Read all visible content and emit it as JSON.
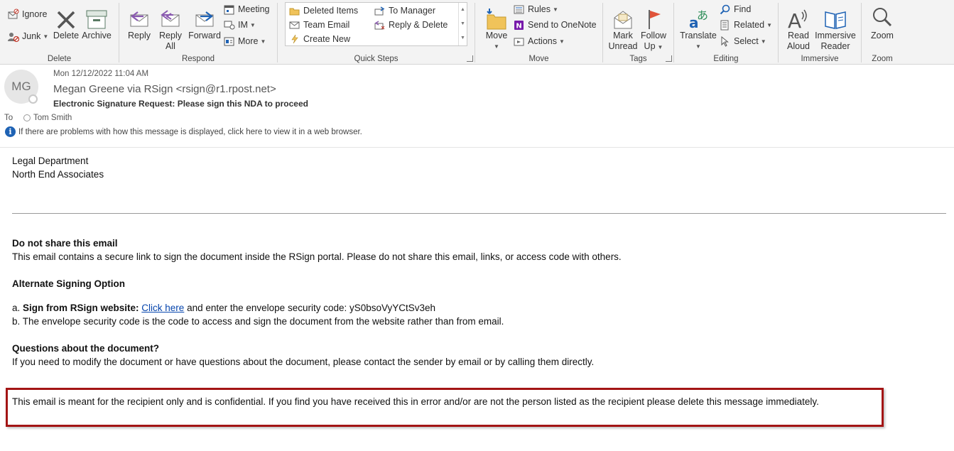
{
  "ribbon": {
    "delete": {
      "label": "Delete",
      "ignore": "Ignore",
      "junk": "Junk",
      "delete_btn": "Delete",
      "archive": "Archive"
    },
    "respond": {
      "label": "Respond",
      "reply": "Reply",
      "reply_all_1": "Reply",
      "reply_all_2": "All",
      "forward": "Forward",
      "meeting": "Meeting",
      "im": "IM",
      "more": "More"
    },
    "quick_steps": {
      "label": "Quick Steps",
      "items": [
        "Deleted Items",
        "To Manager",
        "Team Email",
        "Reply & Delete",
        "Create New"
      ]
    },
    "move": {
      "label": "Move",
      "move_btn": "Move",
      "rules": "Rules",
      "send_onenote": "Send to OneNote",
      "actions": "Actions"
    },
    "tags": {
      "label": "Tags",
      "mark_1": "Mark",
      "mark_2": "Unread",
      "follow_1": "Follow",
      "follow_2": "Up"
    },
    "editing": {
      "label": "Editing",
      "translate": "Translate",
      "find": "Find",
      "related": "Related",
      "select": "Select"
    },
    "immersive": {
      "label": "Immersive",
      "read_1": "Read",
      "read_2": "Aloud",
      "reader_1": "Immersive",
      "reader_2": "Reader"
    },
    "zoom": {
      "label": "Zoom",
      "zoom_btn": "Zoom"
    }
  },
  "header": {
    "avatar_initials": "MG",
    "date": "Mon 12/12/2022 11:04 AM",
    "from": "Megan Greene via RSign <rsign@r1.rpost.net>",
    "subject": "Electronic Signature Request: Please sign this NDA to proceed",
    "to_label": "To",
    "to_name": "Tom Smith",
    "info_message": "If there are problems with how this message is displayed, click here to view it in a web browser."
  },
  "body": {
    "sig_line1": "Legal Department",
    "sig_line2": "North End Associates",
    "share_heading": "Do not share this email",
    "share_text": "This email contains a secure link to sign the document inside the RSign portal. Please do not share this email, links, or access code with others.",
    "alt_heading": "Alternate Signing Option",
    "alt_a_prefix": "a. ",
    "alt_a_bold": "Sign from RSign website:",
    "alt_a_link": "Click here",
    "alt_a_suffix": " and enter the envelope security code: yS0bsoVyYCtSv3eh",
    "alt_b": "b. The envelope security code is the code to access and sign the document from the website rather than from email.",
    "questions_heading": "Questions about the document?",
    "questions_text": "If you need to modify the document or have questions about the document, please contact the sender by email or by calling them directly.",
    "confidential": "This email is meant for the recipient only and is confidential. If you find you have received this in error and/or are not the person listed as the recipient please delete this message immediately."
  },
  "colors": {
    "ribbon_bg": "#f3f3f3",
    "link": "#0645ad",
    "highlight_border": "#a31515",
    "info_icon": "#1e62b4"
  }
}
